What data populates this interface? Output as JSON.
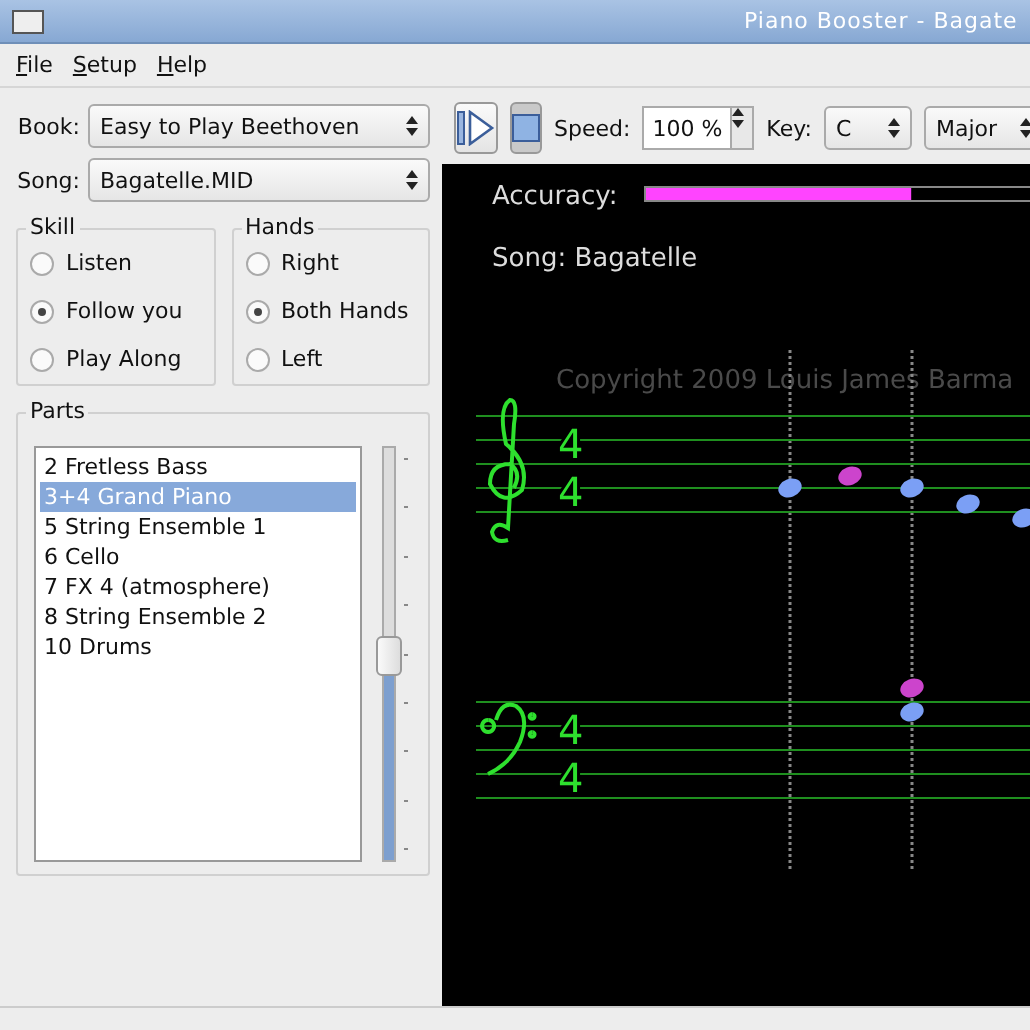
{
  "window": {
    "title": "Piano Booster - Bagate"
  },
  "menu": [
    {
      "label": "File"
    },
    {
      "label": "Setup"
    },
    {
      "label": "Help"
    }
  ],
  "book": {
    "label": "Book:",
    "value": "Easy to Play Beethoven"
  },
  "song": {
    "label": "Song:",
    "value": "Bagatelle.MID"
  },
  "toolbar": {
    "play": {
      "pressed": false
    },
    "stop": {
      "pressed": true
    },
    "speed": {
      "label": "Speed:",
      "value": "100 %"
    },
    "key": {
      "label": "Key:",
      "value": "C"
    },
    "mode": {
      "value": "Major"
    }
  },
  "skill": {
    "title": "Skill",
    "options": [
      {
        "label": "Listen",
        "selected": false
      },
      {
        "label": "Follow you",
        "selected": true
      },
      {
        "label": "Play Along",
        "selected": false
      }
    ]
  },
  "hands": {
    "title": "Hands",
    "options": [
      {
        "label": "Right",
        "selected": false
      },
      {
        "label": "Both Hands",
        "selected": true
      },
      {
        "label": "Left",
        "selected": false
      }
    ]
  },
  "parts": {
    "title": "Parts",
    "items": [
      {
        "label": "2 Fretless Bass",
        "selected": false
      },
      {
        "label": "3+4 Grand Piano",
        "selected": true
      },
      {
        "label": "5 String Ensemble 1",
        "selected": false
      },
      {
        "label": "6 Cello",
        "selected": false
      },
      {
        "label": "7 FX 4 (atmosphere)",
        "selected": false
      },
      {
        "label": "8 String Ensemble 2",
        "selected": false
      },
      {
        "label": "10 Drums",
        "selected": false
      }
    ],
    "slider": {
      "level": 0.49
    }
  },
  "score": {
    "accuracy": {
      "label": "Accuracy:",
      "level": 0.68
    },
    "song_title": "Song: Bagatelle",
    "copyright": "Copyright 2009 Louis James Barma",
    "treble_time": [
      "4",
      "4"
    ],
    "bass_time": [
      "4",
      "4"
    ]
  }
}
